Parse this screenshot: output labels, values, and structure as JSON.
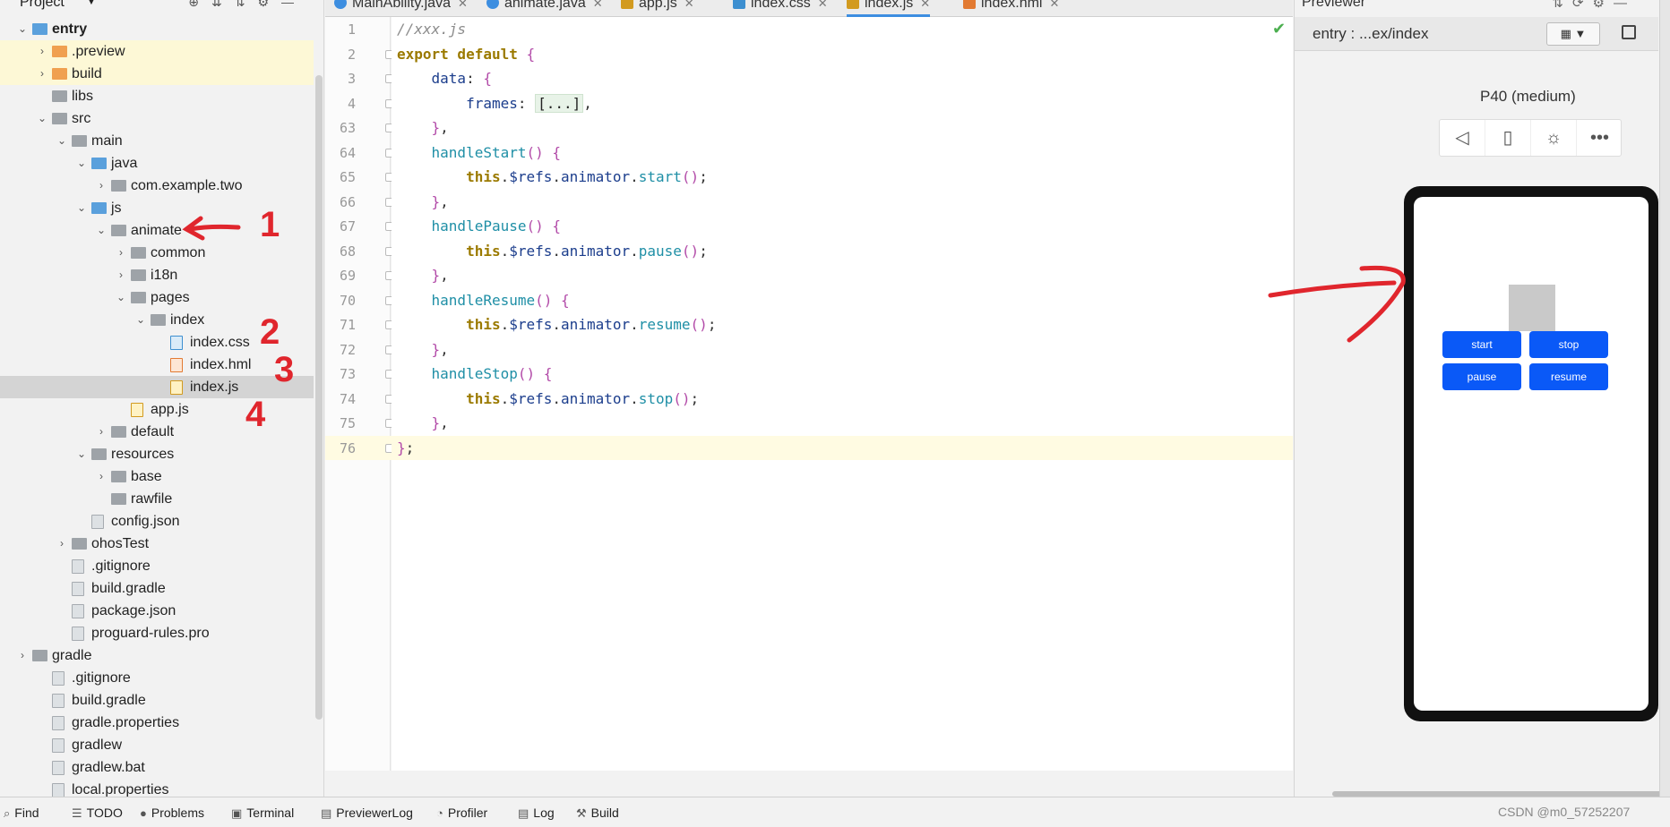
{
  "project": {
    "title": "Project",
    "tree": [
      {
        "label": "entry",
        "depth": 0,
        "arrow": "v",
        "icon": "module",
        "bold": true
      },
      {
        "label": ".preview",
        "depth": 1,
        "arrow": ">",
        "icon": "folder-orange",
        "yellow": true
      },
      {
        "label": "build",
        "depth": 1,
        "arrow": ">",
        "icon": "folder-orange",
        "yellow": true
      },
      {
        "label": "libs",
        "depth": 1,
        "arrow": "",
        "icon": "folder"
      },
      {
        "label": "src",
        "depth": 1,
        "arrow": "v",
        "icon": "folder"
      },
      {
        "label": "main",
        "depth": 2,
        "arrow": "v",
        "icon": "folder"
      },
      {
        "label": "java",
        "depth": 3,
        "arrow": "v",
        "icon": "folder-blue"
      },
      {
        "label": "com.example.two",
        "depth": 4,
        "arrow": ">",
        "icon": "folder"
      },
      {
        "label": "js",
        "depth": 3,
        "arrow": "v",
        "icon": "folder-blue"
      },
      {
        "label": "animate",
        "depth": 4,
        "arrow": "v",
        "icon": "folder"
      },
      {
        "label": "common",
        "depth": 5,
        "arrow": ">",
        "icon": "folder"
      },
      {
        "label": "i18n",
        "depth": 5,
        "arrow": ">",
        "icon": "folder"
      },
      {
        "label": "pages",
        "depth": 5,
        "arrow": "v",
        "icon": "folder"
      },
      {
        "label": "index",
        "depth": 6,
        "arrow": "v",
        "icon": "folder"
      },
      {
        "label": "index.css",
        "depth": 7,
        "arrow": "",
        "icon": "file-css"
      },
      {
        "label": "index.hml",
        "depth": 7,
        "arrow": "",
        "icon": "file-hml"
      },
      {
        "label": "index.js",
        "depth": 7,
        "arrow": "",
        "icon": "file-js",
        "selected": true
      },
      {
        "label": "app.js",
        "depth": 5,
        "arrow": "",
        "icon": "file-js"
      },
      {
        "label": "default",
        "depth": 4,
        "arrow": ">",
        "icon": "folder"
      },
      {
        "label": "resources",
        "depth": 3,
        "arrow": "v",
        "icon": "folder"
      },
      {
        "label": "base",
        "depth": 4,
        "arrow": ">",
        "icon": "folder"
      },
      {
        "label": "rawfile",
        "depth": 4,
        "arrow": "",
        "icon": "folder"
      },
      {
        "label": "config.json",
        "depth": 3,
        "arrow": "",
        "icon": "file"
      },
      {
        "label": "ohosTest",
        "depth": 2,
        "arrow": ">",
        "icon": "folder"
      },
      {
        "label": ".gitignore",
        "depth": 2,
        "arrow": "",
        "icon": "file"
      },
      {
        "label": "build.gradle",
        "depth": 2,
        "arrow": "",
        "icon": "file"
      },
      {
        "label": "package.json",
        "depth": 2,
        "arrow": "",
        "icon": "file"
      },
      {
        "label": "proguard-rules.pro",
        "depth": 2,
        "arrow": "",
        "icon": "file"
      },
      {
        "label": "gradle",
        "depth": 0,
        "arrow": ">",
        "icon": "folder"
      },
      {
        "label": ".gitignore",
        "depth": 1,
        "arrow": "",
        "icon": "file"
      },
      {
        "label": "build.gradle",
        "depth": 1,
        "arrow": "",
        "icon": "file"
      },
      {
        "label": "gradle.properties",
        "depth": 1,
        "arrow": "",
        "icon": "file"
      },
      {
        "label": "gradlew",
        "depth": 1,
        "arrow": "",
        "icon": "file"
      },
      {
        "label": "gradlew.bat",
        "depth": 1,
        "arrow": "",
        "icon": "file"
      },
      {
        "label": "local.properties",
        "depth": 1,
        "arrow": "",
        "icon": "file"
      }
    ]
  },
  "tabs": [
    {
      "label": "MainAbility.java",
      "icon": "java"
    },
    {
      "label": "animate.java",
      "icon": "java"
    },
    {
      "label": "app.js",
      "icon": "js"
    },
    {
      "label": "index.css",
      "icon": "css"
    },
    {
      "label": "index.js",
      "icon": "js",
      "active": true
    },
    {
      "label": "index.hml",
      "icon": "hml"
    }
  ],
  "editor": {
    "lines": [
      {
        "num": "1",
        "segs": [
          [
            "c-cmt",
            "//xxx.js"
          ]
        ]
      },
      {
        "num": "2",
        "segs": [
          [
            "c-kw",
            "export default "
          ],
          [
            "c-br",
            "{"
          ]
        ]
      },
      {
        "num": "3",
        "segs": [
          [
            "",
            "    "
          ],
          [
            "c-prop",
            "data"
          ],
          [
            "c-punc",
            ": "
          ],
          [
            "c-br",
            "{"
          ]
        ]
      },
      {
        "num": "4",
        "segs": [
          [
            "",
            "        "
          ],
          [
            "c-prop",
            "frames"
          ],
          [
            "c-punc",
            ": "
          ],
          [
            "c-fold",
            "[...]"
          ],
          [
            "c-punc",
            ","
          ]
        ]
      },
      {
        "num": "63",
        "segs": [
          [
            "",
            "    "
          ],
          [
            "c-br",
            "}"
          ],
          [
            "c-punc",
            ","
          ]
        ]
      },
      {
        "num": "64",
        "segs": [
          [
            "",
            "    "
          ],
          [
            "c-fn",
            "handleStart"
          ],
          [
            "c-br",
            "() {"
          ]
        ]
      },
      {
        "num": "65",
        "segs": [
          [
            "",
            "        "
          ],
          [
            "c-this",
            "this"
          ],
          [
            "c-punc",
            "."
          ],
          [
            "c-prop",
            "$refs"
          ],
          [
            "c-punc",
            "."
          ],
          [
            "c-prop",
            "animator"
          ],
          [
            "c-punc",
            "."
          ],
          [
            "c-fn",
            "start"
          ],
          [
            "c-br",
            "()"
          ],
          [
            "c-punc",
            ";"
          ]
        ]
      },
      {
        "num": "66",
        "segs": [
          [
            "",
            "    "
          ],
          [
            "c-br",
            "}"
          ],
          [
            "c-punc",
            ","
          ]
        ]
      },
      {
        "num": "67",
        "segs": [
          [
            "",
            "    "
          ],
          [
            "c-fn",
            "handlePause"
          ],
          [
            "c-br",
            "() {"
          ]
        ]
      },
      {
        "num": "68",
        "segs": [
          [
            "",
            "        "
          ],
          [
            "c-this",
            "this"
          ],
          [
            "c-punc",
            "."
          ],
          [
            "c-prop",
            "$refs"
          ],
          [
            "c-punc",
            "."
          ],
          [
            "c-prop",
            "animator"
          ],
          [
            "c-punc",
            "."
          ],
          [
            "c-fn",
            "pause"
          ],
          [
            "c-br",
            "()"
          ],
          [
            "c-punc",
            ";"
          ]
        ]
      },
      {
        "num": "69",
        "segs": [
          [
            "",
            "    "
          ],
          [
            "c-br",
            "}"
          ],
          [
            "c-punc",
            ","
          ]
        ]
      },
      {
        "num": "70",
        "segs": [
          [
            "",
            "    "
          ],
          [
            "c-fn",
            "handleResume"
          ],
          [
            "c-br",
            "() {"
          ]
        ]
      },
      {
        "num": "71",
        "segs": [
          [
            "",
            "        "
          ],
          [
            "c-this",
            "this"
          ],
          [
            "c-punc",
            "."
          ],
          [
            "c-prop",
            "$refs"
          ],
          [
            "c-punc",
            "."
          ],
          [
            "c-prop",
            "animator"
          ],
          [
            "c-punc",
            "."
          ],
          [
            "c-fn",
            "resume"
          ],
          [
            "c-br",
            "()"
          ],
          [
            "c-punc",
            ";"
          ]
        ]
      },
      {
        "num": "72",
        "segs": [
          [
            "",
            "    "
          ],
          [
            "c-br",
            "}"
          ],
          [
            "c-punc",
            ","
          ]
        ]
      },
      {
        "num": "73",
        "segs": [
          [
            "",
            "    "
          ],
          [
            "c-fn",
            "handleStop"
          ],
          [
            "c-br",
            "() {"
          ]
        ]
      },
      {
        "num": "74",
        "segs": [
          [
            "",
            "        "
          ],
          [
            "c-this",
            "this"
          ],
          [
            "c-punc",
            "."
          ],
          [
            "c-prop",
            "$refs"
          ],
          [
            "c-punc",
            "."
          ],
          [
            "c-prop",
            "animator"
          ],
          [
            "c-punc",
            "."
          ],
          [
            "c-fn",
            "stop"
          ],
          [
            "c-br",
            "()"
          ],
          [
            "c-punc",
            ";"
          ]
        ]
      },
      {
        "num": "75",
        "segs": [
          [
            "",
            "    "
          ],
          [
            "c-br",
            "}"
          ],
          [
            "c-punc",
            ","
          ]
        ]
      },
      {
        "num": "76",
        "segs": [
          [
            "c-br",
            "}"
          ],
          [
            "c-punc",
            ";"
          ]
        ],
        "current": true
      }
    ]
  },
  "previewer": {
    "title": "Previewer",
    "path": "entry : ...ex/index",
    "device": "P40 (medium)",
    "buttons": {
      "start": "start",
      "stop": "stop",
      "pause": "pause",
      "resume": "resume"
    },
    "accent": "#0a59f7"
  },
  "bottombar": [
    {
      "label": "Find",
      "icon": "search-icon"
    },
    {
      "label": "TODO",
      "icon": "list-icon"
    },
    {
      "label": "Problems",
      "icon": "info-icon"
    },
    {
      "label": "Terminal",
      "icon": "terminal-icon"
    },
    {
      "label": "PreviewerLog",
      "icon": "log-icon"
    },
    {
      "label": "Profiler",
      "icon": "gauge-icon"
    },
    {
      "label": "Log",
      "icon": "log-icon"
    },
    {
      "label": "Build",
      "icon": "hammer-icon"
    }
  ],
  "watermark": "CSDN @m0_57252207",
  "annotations": [
    "1",
    "2",
    "3",
    "4"
  ]
}
